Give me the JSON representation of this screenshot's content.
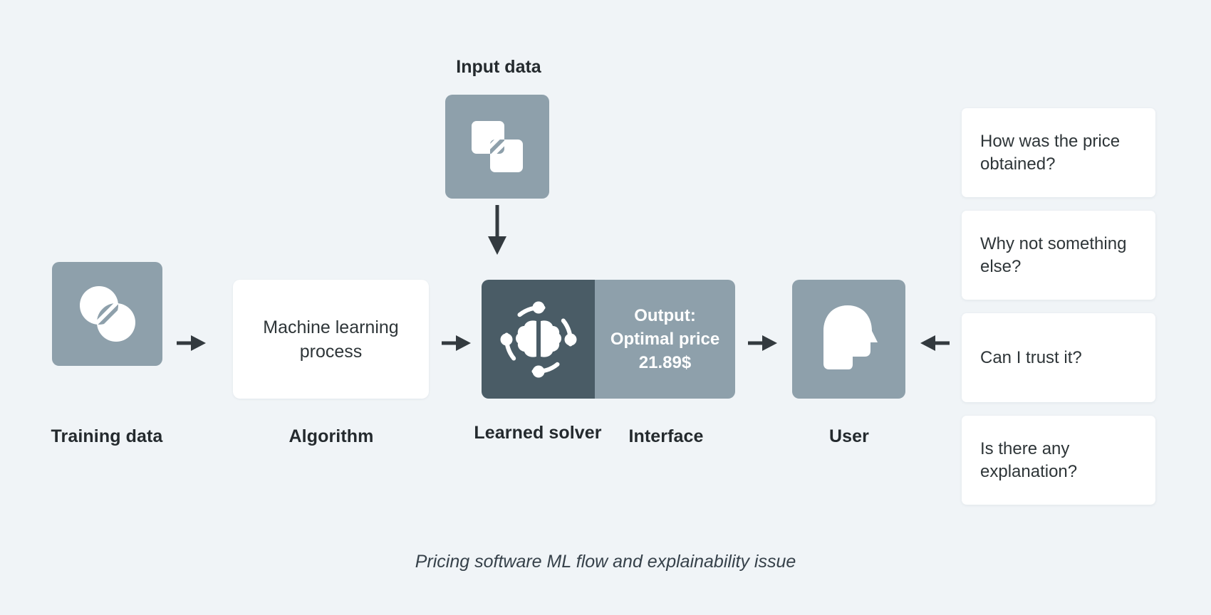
{
  "diagram": {
    "caption": "Pricing software ML flow and explainability issue",
    "background_color": "#f0f4f7",
    "slate_color": "#8ea0ab",
    "dark_slate_color": "#4a5c66",
    "card_color": "#ffffff",
    "arrow_color": "#333a3f",
    "nodes": {
      "input_data": {
        "label": "Input data",
        "label_position": "top",
        "icon": "overlapping-squares-icon"
      },
      "training_data": {
        "label": "Training data",
        "label_position": "bottom",
        "icon": "overlapping-circles-icon"
      },
      "algorithm": {
        "label": "Algorithm",
        "label_position": "bottom",
        "body_text": "Machine learning process"
      },
      "learned_solver": {
        "label": "Learned solver",
        "label_position": "bottom",
        "icon": "brain-ai-icon"
      },
      "interface": {
        "label": "Interface",
        "label_position": "bottom",
        "output_lines": [
          "Output:",
          "Optimal price",
          "21.89$"
        ]
      },
      "user": {
        "label": "User",
        "label_position": "bottom",
        "icon": "head-profile-icon"
      }
    },
    "questions": [
      "How was the price obtained?",
      "Why not something else?",
      "Can I trust it?",
      "Is there any explanation?"
    ],
    "arrows": [
      {
        "name": "training-to-algorithm",
        "direction": "right"
      },
      {
        "name": "algorithm-to-solver",
        "direction": "right"
      },
      {
        "name": "input-to-solver",
        "direction": "down"
      },
      {
        "name": "interface-to-user",
        "direction": "right"
      },
      {
        "name": "questions-to-user",
        "direction": "left"
      }
    ]
  }
}
